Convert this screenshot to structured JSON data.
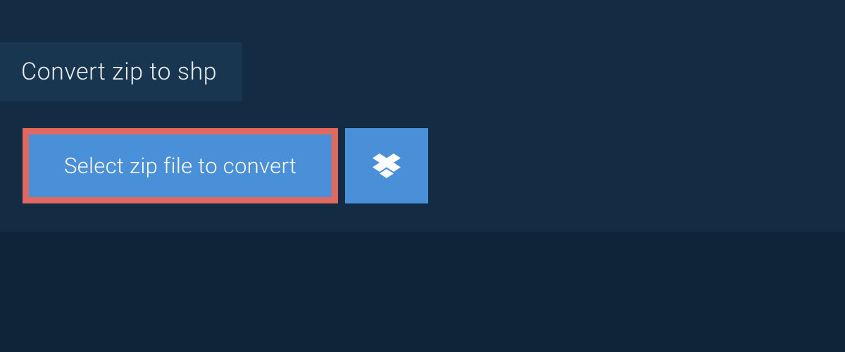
{
  "header": {
    "title": "Convert zip to shp"
  },
  "actions": {
    "select_label": "Select zip file to convert"
  },
  "colors": {
    "background_outer": "#0f2438",
    "background_panel": "#132c43",
    "background_tab": "#193650",
    "button_primary": "#4a90d9",
    "button_highlight_border": "#e0685f",
    "text_light": "#e8ecef",
    "text_on_primary": "#ffffff"
  }
}
